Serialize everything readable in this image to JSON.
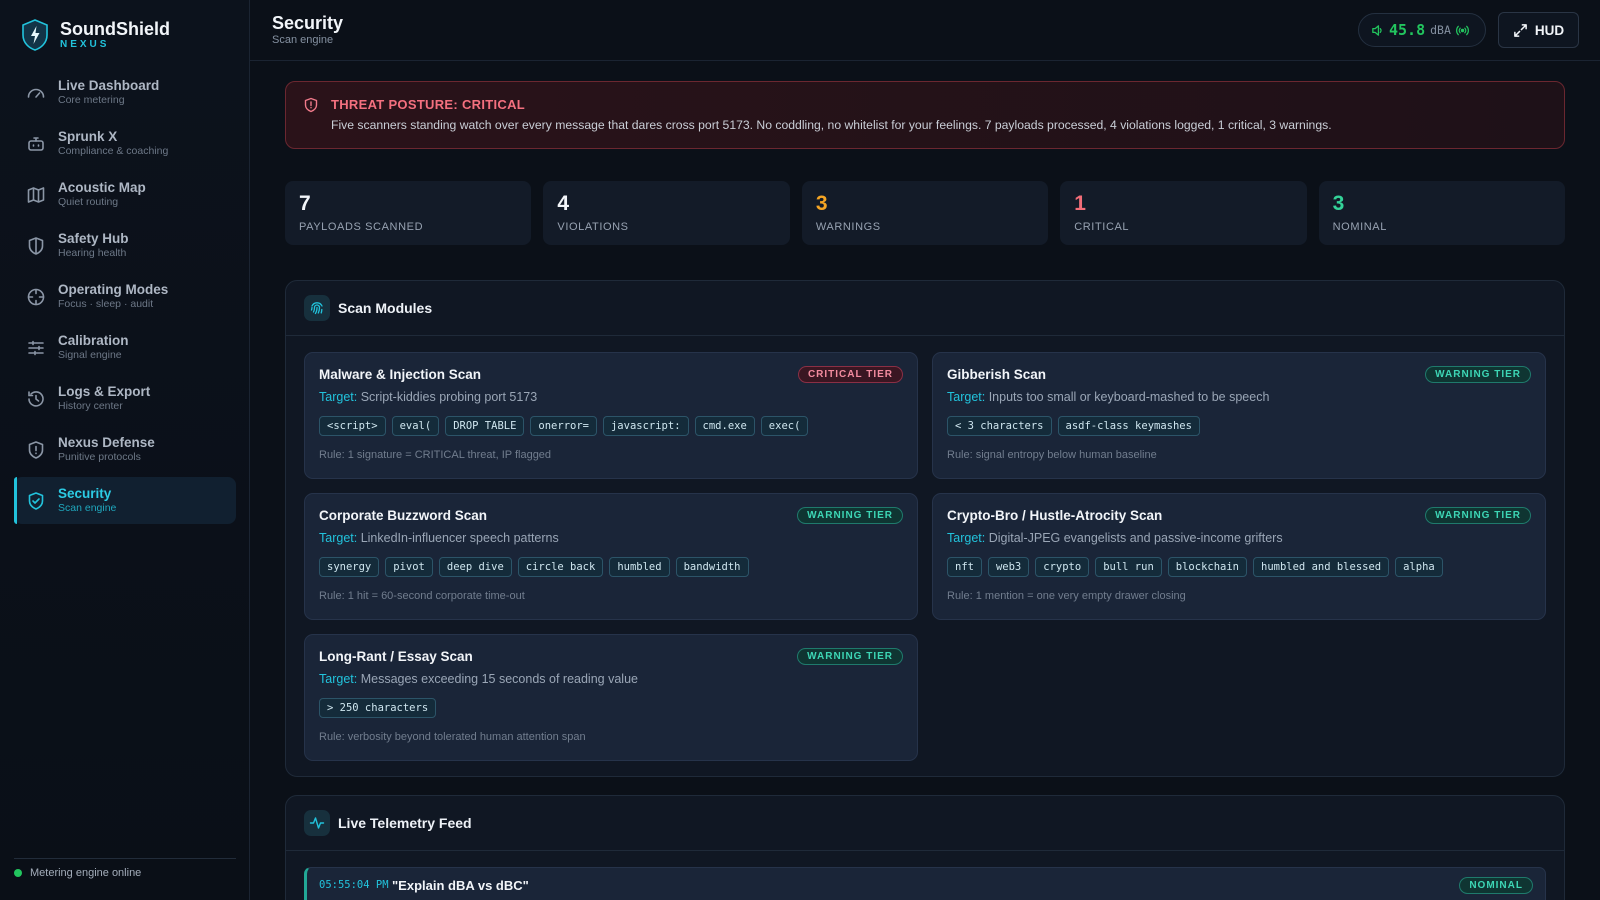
{
  "brand": {
    "name": "SoundShield",
    "sub": "NEXUS"
  },
  "nav": [
    {
      "title": "Live Dashboard",
      "sub": "Core metering",
      "icon": "gauge-icon"
    },
    {
      "title": "Sprunk X",
      "sub": "Compliance & coaching",
      "icon": "robot-icon"
    },
    {
      "title": "Acoustic Map",
      "sub": "Quiet routing",
      "icon": "map-icon"
    },
    {
      "title": "Safety Hub",
      "sub": "Hearing health",
      "icon": "shield-half-icon"
    },
    {
      "title": "Operating Modes",
      "sub": "Focus · sleep · audit",
      "icon": "crosshair-icon"
    },
    {
      "title": "Calibration",
      "sub": "Signal engine",
      "icon": "sliders-icon"
    },
    {
      "title": "Logs & Export",
      "sub": "History center",
      "icon": "history-icon"
    },
    {
      "title": "Nexus Defense",
      "sub": "Punitive protocols",
      "icon": "shield-alert-icon"
    },
    {
      "title": "Security",
      "sub": "Scan engine",
      "icon": "shield-check-icon",
      "active": true
    }
  ],
  "footer": {
    "status": "Metering engine online"
  },
  "header": {
    "title": "Security",
    "subtitle": "Scan engine",
    "meter_value": "45.8",
    "meter_unit": "dBA",
    "hud_label": "HUD"
  },
  "alert": {
    "title": "THREAT POSTURE: CRITICAL",
    "text": "Five scanners standing watch over every message that dares cross port 5173. No coddling, no whitelist for your feelings. 7 payloads processed, 4 violations logged, 1 critical, 3 warnings."
  },
  "stats": [
    {
      "value": "7",
      "label": "PAYLOADS SCANNED",
      "color": "#f2f5f9"
    },
    {
      "value": "4",
      "label": "VIOLATIONS",
      "color": "#f2f5f9"
    },
    {
      "value": "3",
      "label": "WARNINGS",
      "color": "#f5a524"
    },
    {
      "value": "1",
      "label": "CRITICAL",
      "color": "#f26d78"
    },
    {
      "value": "3",
      "label": "NOMINAL",
      "color": "#34d399"
    }
  ],
  "scan_modules": {
    "title": "Scan Modules",
    "target_label": "Target:",
    "items": [
      {
        "title": "Malware & Injection Scan",
        "tier": "CRITICAL TIER",
        "target": "Script-kiddies probing port 5173",
        "chips": [
          "<script>",
          "eval(",
          "DROP TABLE",
          "onerror=",
          "javascript:",
          "cmd.exe",
          "exec("
        ],
        "rule": "Rule: 1 signature = CRITICAL threat, IP flagged"
      },
      {
        "title": "Gibberish Scan",
        "tier": "WARNING TIER",
        "target": "Inputs too small or keyboard-mashed to be speech",
        "chips": [
          "< 3 characters",
          "asdf-class keymashes"
        ],
        "rule": "Rule: signal entropy below human baseline"
      },
      {
        "title": "Corporate Buzzword Scan",
        "tier": "WARNING TIER",
        "target": "LinkedIn-influencer speech patterns",
        "chips": [
          "synergy",
          "pivot",
          "deep dive",
          "circle back",
          "humbled",
          "bandwidth"
        ],
        "rule": "Rule: 1 hit = 60-second corporate time-out"
      },
      {
        "title": "Crypto-Bro / Hustle-Atrocity Scan",
        "tier": "WARNING TIER",
        "target": "Digital-JPEG evangelists and passive-income grifters",
        "chips": [
          "nft",
          "web3",
          "crypto",
          "bull run",
          "blockchain",
          "humbled and blessed",
          "alpha"
        ],
        "rule": "Rule: 1 mention = one very empty drawer closing"
      },
      {
        "title": "Long-Rant / Essay Scan",
        "tier": "WARNING TIER",
        "target": "Messages exceeding 15 seconds of reading value",
        "chips": [
          "> 250 characters"
        ],
        "rule": "Rule: verbosity beyond tolerated human attention span"
      }
    ]
  },
  "telemetry": {
    "title": "Live Telemetry Feed",
    "rows": [
      {
        "time": "05:55:04 PM",
        "message": "\"Explain dBA vs dBC\"",
        "status": "NOMINAL"
      }
    ]
  }
}
